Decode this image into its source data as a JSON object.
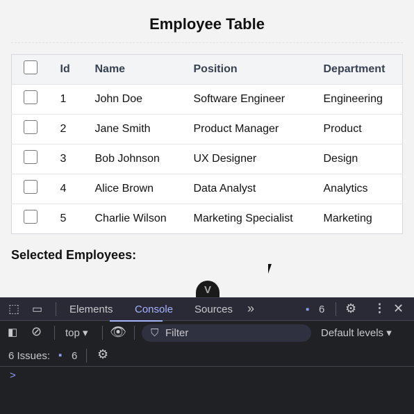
{
  "page": {
    "title": "Employee Table",
    "selected_heading": "Selected Employees:"
  },
  "table": {
    "headers": [
      "Id",
      "Name",
      "Position",
      "Department"
    ],
    "rows": [
      {
        "id": "1",
        "name": "John Doe",
        "position": "Software Engineer",
        "department": "Engineering",
        "checked": false
      },
      {
        "id": "2",
        "name": "Jane Smith",
        "position": "Product Manager",
        "department": "Product",
        "checked": false
      },
      {
        "id": "3",
        "name": "Bob Johnson",
        "position": "UX Designer",
        "department": "Design",
        "checked": false
      },
      {
        "id": "4",
        "name": "Alice Brown",
        "position": "Data Analyst",
        "department": "Analytics",
        "checked": false
      },
      {
        "id": "5",
        "name": "Charlie Wilson",
        "position": "Marketing Specialist",
        "department": "Marketing",
        "checked": false
      }
    ]
  },
  "devtools": {
    "tabs": [
      "Elements",
      "Console",
      "Sources"
    ],
    "active_tab": "Console",
    "more": "»",
    "issues_badge": "6",
    "context": "top",
    "filter_placeholder": "Filter",
    "levels": "Default levels",
    "issues_label": "6 Issues:",
    "issues_count": "6",
    "prompt": ">",
    "accent": "#a6b4ff"
  }
}
